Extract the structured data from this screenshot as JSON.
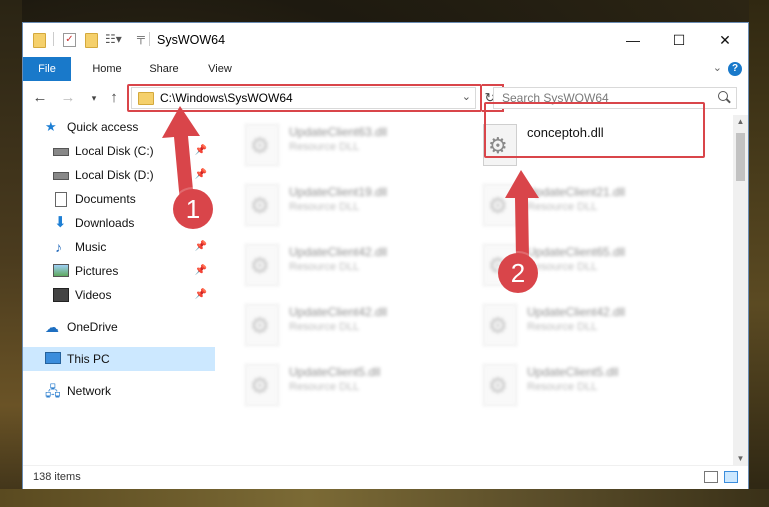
{
  "window": {
    "title": "SysWOW64",
    "controls": {
      "minimize": "—",
      "maximize": "☐",
      "close": "✕"
    }
  },
  "ribbon": {
    "tabs": [
      "File",
      "Home",
      "Share",
      "View"
    ],
    "help": "?"
  },
  "navigation": {
    "address": "C:\\Windows\\SysWOW64",
    "search_placeholder": "Search SysWOW64"
  },
  "sidebar": {
    "items": [
      {
        "label": "Quick access",
        "icon": "star-icon"
      },
      {
        "label": "Local Disk (C:)",
        "icon": "drive-icon",
        "pinned": true
      },
      {
        "label": "Local Disk (D:)",
        "icon": "drive-icon",
        "pinned": true
      },
      {
        "label": "Documents",
        "icon": "documents-icon",
        "pinned": true
      },
      {
        "label": "Downloads",
        "icon": "download-icon",
        "pinned": true
      },
      {
        "label": "Music",
        "icon": "music-icon",
        "pinned": true
      },
      {
        "label": "Pictures",
        "icon": "pictures-icon",
        "pinned": true
      },
      {
        "label": "Videos",
        "icon": "videos-icon",
        "pinned": true
      },
      {
        "label": "OneDrive",
        "icon": "cloud-icon"
      },
      {
        "label": "This PC",
        "icon": "computer-icon",
        "selected": true
      },
      {
        "label": "Network",
        "icon": "network-icon"
      }
    ]
  },
  "files": [
    {
      "name": "UpdateClient63.dll",
      "type": "Resource DLL"
    },
    {
      "name": "conceptoh.dll",
      "type": ""
    },
    {
      "name": "UpdateClient19.dll",
      "type": "Resource DLL"
    },
    {
      "name": "UpdateClient21.dll",
      "type": "Resource DLL"
    },
    {
      "name": "UpdateClient42.dll",
      "type": "Resource DLL"
    },
    {
      "name": "UpdateClient65.dll",
      "type": "Resource DLL"
    },
    {
      "name": "UpdateClient42.dll",
      "type": "Resource DLL"
    },
    {
      "name": "UpdateClient42.dll",
      "type": "Resource DLL"
    },
    {
      "name": "UpdateClient5.dll",
      "type": "Resource DLL"
    },
    {
      "name": "UpdateClient5.dll",
      "type": "Resource DLL"
    }
  ],
  "status": {
    "item_count": "138 items"
  },
  "annotations": {
    "step1": "1",
    "step2": "2",
    "color": "#d9454a"
  }
}
